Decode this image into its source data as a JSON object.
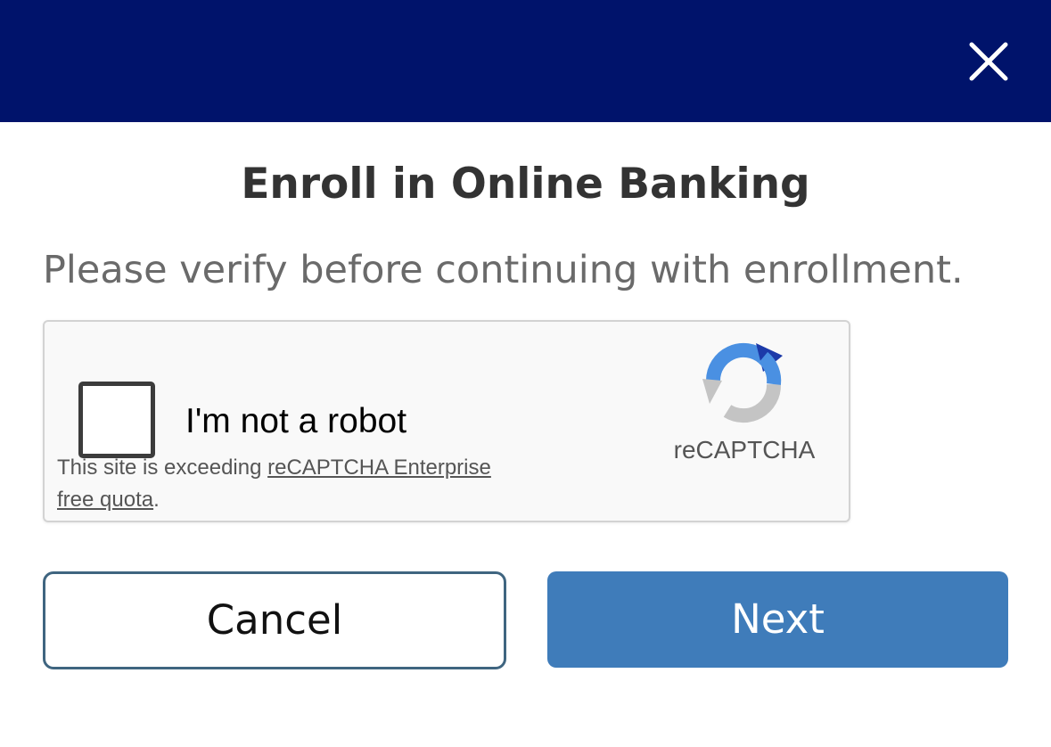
{
  "header": {
    "background_color": "#00136b",
    "close_icon": "close-icon"
  },
  "dialog": {
    "title": "Enroll in Online Banking",
    "subtitle": "Please verify before continuing with enrollment."
  },
  "captcha": {
    "checkbox_label": "I'm not a robot",
    "note_prefix": "This site is exceeding ",
    "note_link": "reCAPTCHA Enterprise free quota",
    "note_suffix": ".",
    "brand": "reCAPTCHA",
    "logo_icon": "recaptcha-logo-icon",
    "checked": false
  },
  "buttons": {
    "cancel_label": "Cancel",
    "next_label": "Next",
    "next_color": "#3f7cba"
  }
}
